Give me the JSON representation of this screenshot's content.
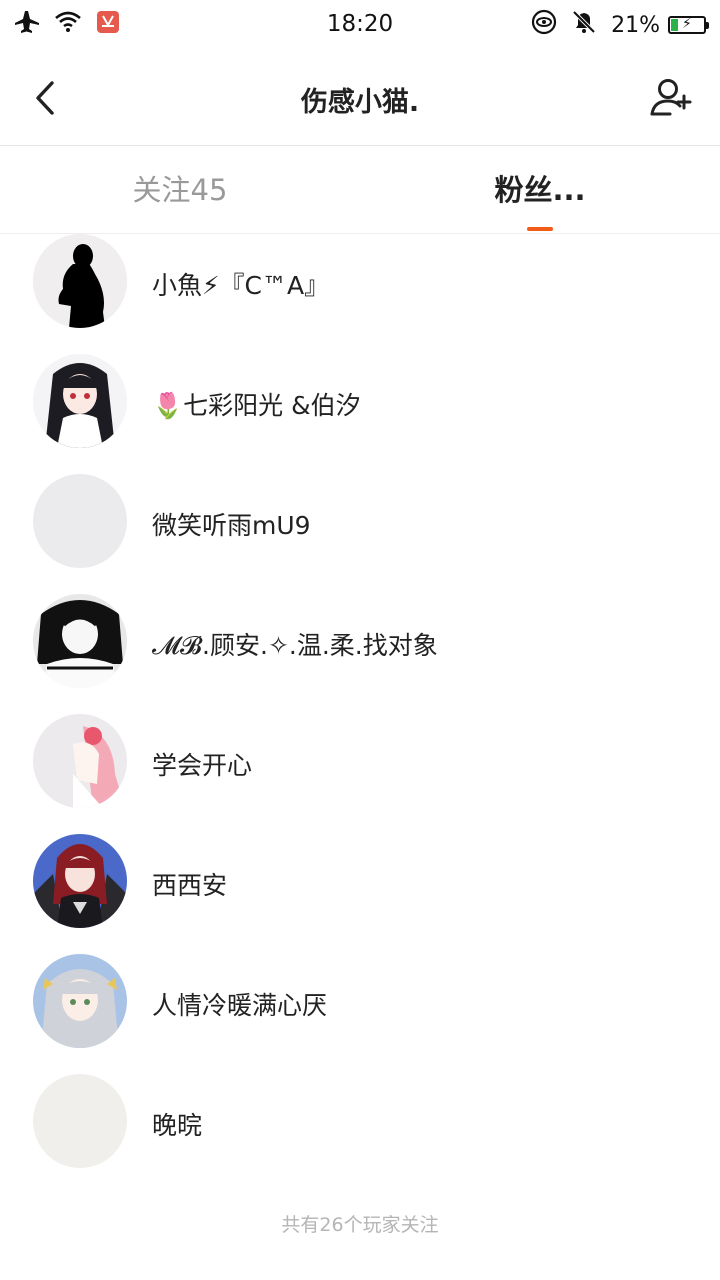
{
  "status_bar": {
    "time": "18:20",
    "battery_percent": "21%",
    "battery_level": 0.21,
    "icons": [
      "airplane-icon",
      "wifi-icon",
      "huawei-app-icon",
      "eye-comfort-icon",
      "mute-icon",
      "battery-icon"
    ]
  },
  "header": {
    "title": "伤感小猫.",
    "back_icon": "chevron-left-icon",
    "add_icon": "add-user-icon"
  },
  "tabs": [
    {
      "label": "关注45",
      "active": false
    },
    {
      "label": "粉丝...",
      "active": true
    }
  ],
  "accent_color": "#f25c19",
  "fans": [
    {
      "name": "小魚⚡『C™A』",
      "avatar": "silhouette"
    },
    {
      "name": "🌷七彩阳光  &伯汐",
      "avatar": "anime-girl-dark-hair"
    },
    {
      "name": "微笑听雨mU9",
      "avatar": "blank-gray"
    },
    {
      "name": "𝓜𝓑.顾安.✧.温.柔.找对象",
      "avatar": "anime-bw"
    },
    {
      "name": "学会开心",
      "avatar": "anime-pink-hair"
    },
    {
      "name": "西西安",
      "avatar": "anime-red-hair"
    },
    {
      "name": "人情冷暖满心厌",
      "avatar": "anime-silver-hair"
    },
    {
      "name": "晚晥",
      "avatar": "blank-beige"
    }
  ],
  "footer_text": "共有26个玩家关注"
}
